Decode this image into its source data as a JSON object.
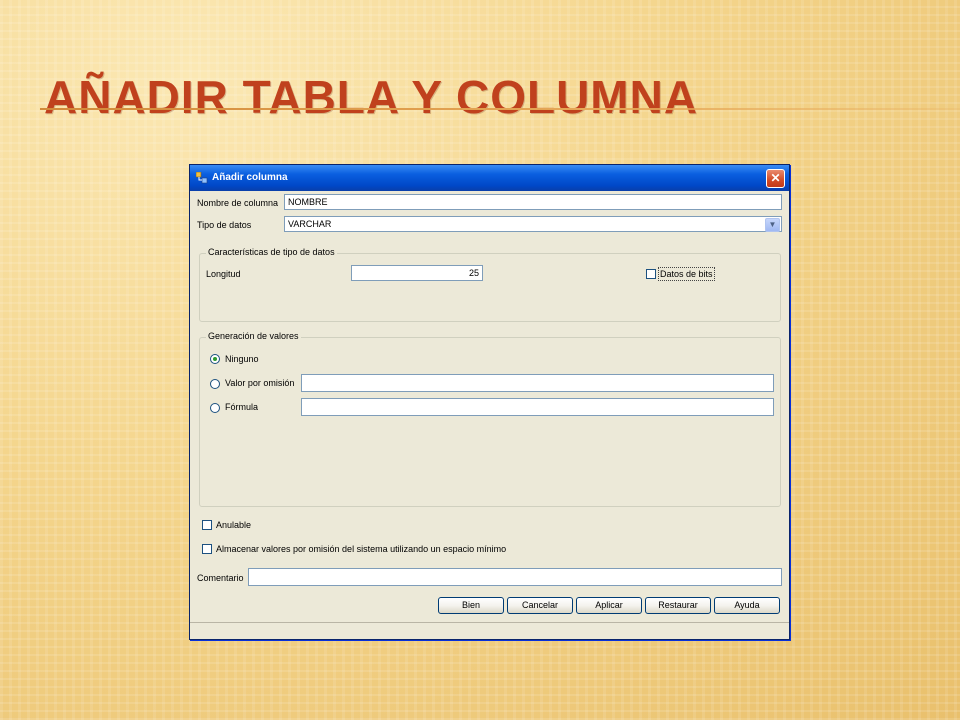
{
  "slide": {
    "title": "AÑADIR TABLA Y COLUMNA"
  },
  "dialog": {
    "title": "Añadir columna",
    "close_icon": "close-icon",
    "column_name_label": "Nombre de columna",
    "column_name_value": "NOMBRE",
    "data_type_label": "Tipo de datos",
    "data_type_value": "VARCHAR",
    "data_type_characteristics": {
      "title": "Características de tipo de datos",
      "length_label": "Longitud",
      "length_value": "25",
      "bit_data_label": "Datos de bits",
      "bit_data_checked": false
    },
    "value_generation": {
      "title": "Generación de valores",
      "options": [
        {
          "label": "Ninguno",
          "selected": true
        },
        {
          "label": "Valor por omisión",
          "selected": false
        },
        {
          "label": "Fórmula",
          "selected": false
        }
      ],
      "default_value": "",
      "formula_value": ""
    },
    "nullable_label": "Anulable",
    "nullable_checked": false,
    "compress_label": "Almacenar valores por omisión del sistema utilizando un espacio mínimo",
    "compress_checked": false,
    "comment_label": "Comentario",
    "comment_value": "",
    "buttons": {
      "ok": "Bien",
      "cancel": "Cancelar",
      "apply": "Aplicar",
      "reset": "Restaurar",
      "help": "Ayuda"
    }
  }
}
